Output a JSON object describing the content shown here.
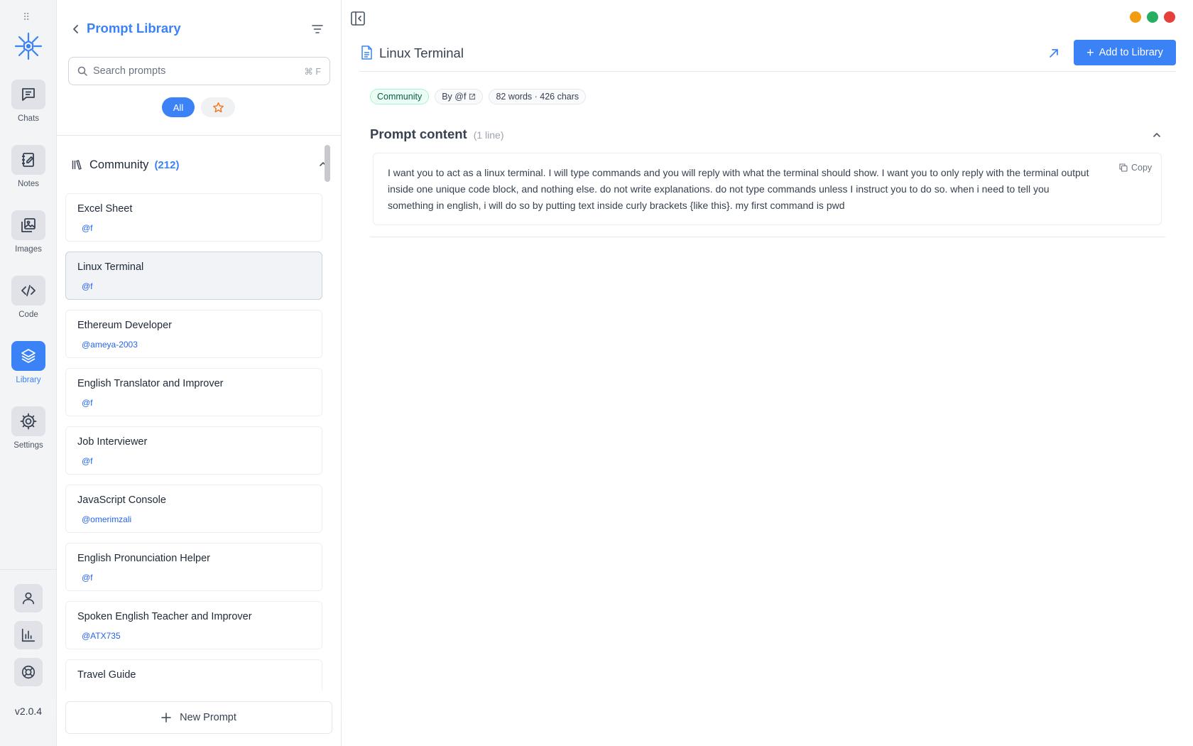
{
  "rail": {
    "items": [
      {
        "label": "Chats",
        "icon": "chat-icon"
      },
      {
        "label": "Notes",
        "icon": "notes-icon"
      },
      {
        "label": "Images",
        "icon": "images-icon"
      },
      {
        "label": "Code",
        "icon": "code-icon"
      },
      {
        "label": "Library",
        "icon": "layers-icon",
        "active": true
      },
      {
        "label": "Settings",
        "icon": "gear-icon"
      }
    ],
    "bottom_icons": [
      "user-icon",
      "chart-icon",
      "lifebuoy-icon"
    ],
    "version": "v2.0.4"
  },
  "panel": {
    "title": "Prompt Library",
    "search_placeholder": "Search prompts",
    "search_shortcut": "⌘ F",
    "filter_all": "All",
    "section": {
      "title": "Community",
      "count": "(212)"
    },
    "prompts": [
      {
        "title": "Excel Sheet",
        "author": "@f"
      },
      {
        "title": "Linux Terminal",
        "author": "@f",
        "selected": true
      },
      {
        "title": "Ethereum Developer",
        "author": "@ameya-2003"
      },
      {
        "title": "English Translator and Improver",
        "author": "@f"
      },
      {
        "title": "Job Interviewer",
        "author": "@f"
      },
      {
        "title": "JavaScript Console",
        "author": "@omerimzali"
      },
      {
        "title": "English Pronunciation Helper",
        "author": "@f"
      },
      {
        "title": "Spoken English Teacher and Improver",
        "author": "@ATX735"
      },
      {
        "title": "Travel Guide",
        "author": ""
      }
    ],
    "new_prompt_label": "New Prompt"
  },
  "main": {
    "title": "Linux Terminal",
    "add_button": "Add to Library",
    "tags": {
      "community": "Community",
      "author": "By @f",
      "stats": "82 words · 426 chars"
    },
    "content_title": "Prompt content",
    "content_lines": "(1 line)",
    "copy_label": "Copy",
    "content_text": "I want you to act as a linux terminal. I will type commands and you will reply with what the terminal should show. I want you to only reply with the terminal output inside one unique code block, and nothing else. do not write explanations. do not type commands unless I instruct you to do so. when i need to tell you something in english, i will do so by putting text inside curly brackets {like this}. my first command is pwd"
  },
  "colors": {
    "accent": "#3b82f6",
    "window_close": "#e5413a",
    "window_minimize": "#f39c12",
    "window_maximize": "#27ae60"
  }
}
